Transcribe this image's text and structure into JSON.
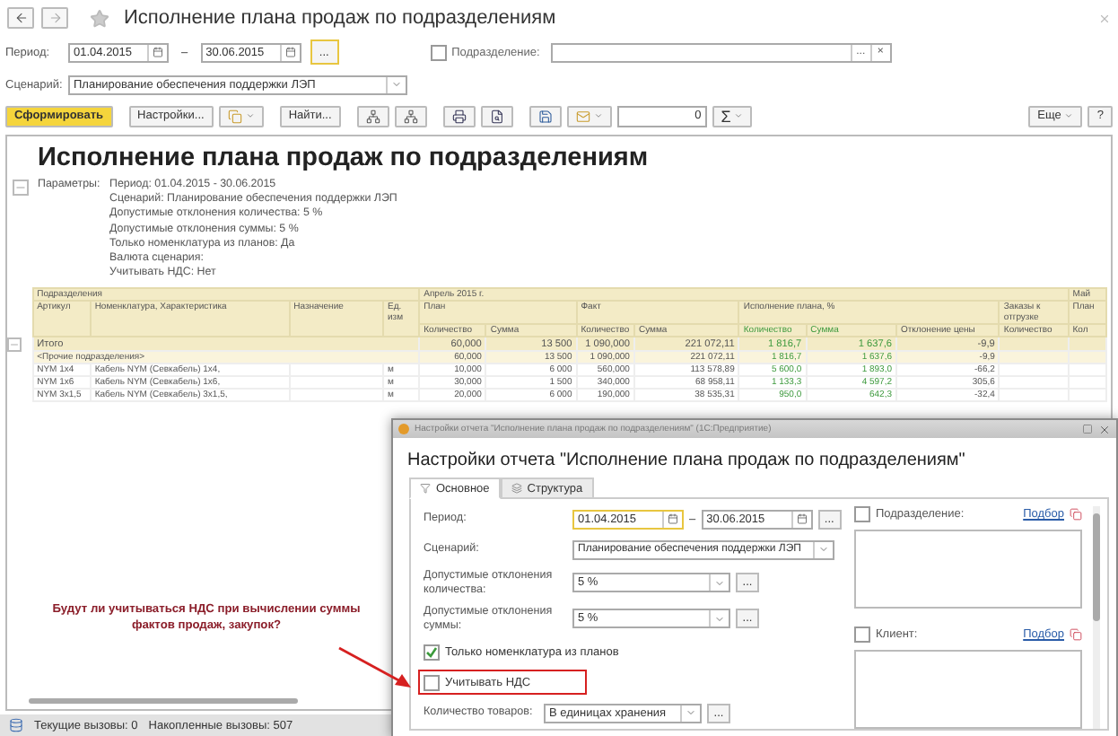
{
  "window": {
    "title": "Исполнение плана продаж по подразделениям"
  },
  "filters": {
    "period_label": "Период:",
    "date_from": "01.04.2015",
    "date_separator": "–",
    "date_to": "30.06.2015",
    "more": "...",
    "department": {
      "label": "Подразделение:",
      "checked": false,
      "more": "...",
      "clear": "×"
    },
    "scenario_label": "Сценарий:",
    "scenario": "Планирование обеспечения поддержки ЛЭП"
  },
  "toolbar": {
    "generate": "Сформировать",
    "settings": "Настройки...",
    "find": "Найти...",
    "counter": "0",
    "sum": "Σ",
    "more": "Еще",
    "help": "?"
  },
  "report": {
    "title": "Исполнение плана продаж по подразделениям",
    "params_label": "Параметры:",
    "params": [
      "Период: 01.04.2015 - 30.06.2015",
      "Сценарий: Планирование обеспечения поддержки ЛЭП",
      "Допустимые отклонения количества: 5 %",
      "Допустимые отклонения суммы: 5 %",
      "Только номенклатура из планов: Да",
      "Валюта сценария:",
      "Учитывать НДС: Нет"
    ],
    "table": {
      "group_header": "Подразделения",
      "period_header": "Апрель 2015 г.",
      "next_period_header": "Май",
      "key_columns": [
        "Артикул",
        "Номенклатура, Характеристика",
        "Назначение",
        "Ед. изм"
      ],
      "column_groups": [
        {
          "label": "План",
          "columns": [
            {
              "label": "Количество",
              "accent": false
            },
            {
              "label": "Сумма",
              "accent": false
            }
          ]
        },
        {
          "label": "Факт",
          "columns": [
            {
              "label": "Количество",
              "accent": false
            },
            {
              "label": "Сумма",
              "accent": false
            }
          ]
        },
        {
          "label": "Исполнение плана, %",
          "columns": [
            {
              "label": "Количество",
              "accent": true
            },
            {
              "label": "Сумма",
              "accent": true
            },
            {
              "label": "Отклонение цены",
              "accent": false
            }
          ]
        },
        {
          "label": "Заказы к отгрузке",
          "columns": [
            {
              "label": "Количество",
              "accent": false
            }
          ]
        }
      ],
      "next_period_groups": [
        {
          "label": "План",
          "columns": [
            {
              "label": "Кол",
              "accent": false
            }
          ]
        }
      ],
      "rows": [
        {
          "kind": "total",
          "label": "Итого",
          "values": [
            "60,000",
            "13 500",
            "1 090,000",
            "221 072,11",
            "1 816,7",
            "1 637,6",
            "-9,9"
          ]
        },
        {
          "kind": "group",
          "label": "<Прочие подразделения>",
          "values": [
            "60,000",
            "13 500",
            "1 090,000",
            "221 072,11",
            "1 816,7",
            "1 637,6",
            "-9,9"
          ]
        },
        {
          "kind": "item",
          "article": "NYM 1x4",
          "name": "Кабель NYM (Севкабель) 1x4,",
          "unit": "м",
          "values": [
            "10,000",
            "6 000",
            "560,000",
            "113 578,89",
            "5 600,0",
            "1 893,0",
            "-66,2"
          ]
        },
        {
          "kind": "item",
          "article": "NYM 1x6",
          "name": "Кабель NYM (Севкабель) 1x6,",
          "unit": "м",
          "values": [
            "30,000",
            "1 500",
            "340,000",
            "68 958,11",
            "1 133,3",
            "4 597,2",
            "305,6"
          ]
        },
        {
          "kind": "item",
          "article": "NYM 3x1,5",
          "name": "Кабель NYM (Севкабель) 3x1,5,",
          "unit": "м",
          "values": [
            "20,000",
            "6 000",
            "190,000",
            "38 535,31",
            "950,0",
            "642,3",
            "-32,4"
          ]
        }
      ]
    }
  },
  "annotation": {
    "text": "Будут ли учитываться НДС при вычислении суммы фактов продаж, закупок?"
  },
  "status_bar": {
    "current": "Текущие вызовы: 0",
    "accumulated": "Накопленные вызовы: 507"
  },
  "dialog": {
    "window_title": "Настройки отчета \"Исполнение плана продаж по подразделениям\" (1С:Предприятие)",
    "heading": "Настройки отчета \"Исполнение плана продаж по подразделениям\"",
    "tabs": [
      {
        "label": "Основное",
        "selected": true
      },
      {
        "label": "Структура",
        "selected": false
      }
    ],
    "fields": [
      {
        "kind": "period",
        "label": "Период:",
        "from": "01.04.2015",
        "separator": "–",
        "to": "30.06.2015",
        "more": "..."
      },
      {
        "kind": "select",
        "label": "Сценарий:",
        "value": "Планирование обеспечения поддержки ЛЭП"
      },
      {
        "kind": "choice",
        "label": "Допустимые отклонения количества:",
        "value": "5 %",
        "more": "..."
      },
      {
        "kind": "choice",
        "label": "Допустимые отклонения суммы:",
        "value": "5 %",
        "more": "..."
      },
      {
        "kind": "checkbox",
        "label": "Только номенклатура из планов",
        "checked": true,
        "highlighted": false
      },
      {
        "kind": "checkbox",
        "label": "Учитывать НДС",
        "checked": false,
        "highlighted": true
      },
      {
        "kind": "compact-choice",
        "label": "Количество товаров:",
        "value": "В единицах хранения",
        "more": "..."
      }
    ],
    "filters": [
      {
        "label": "Подразделение:",
        "checked": false,
        "link": "Подбор"
      },
      {
        "label": "Клиент:",
        "checked": false,
        "link": "Подбор"
      }
    ]
  }
}
